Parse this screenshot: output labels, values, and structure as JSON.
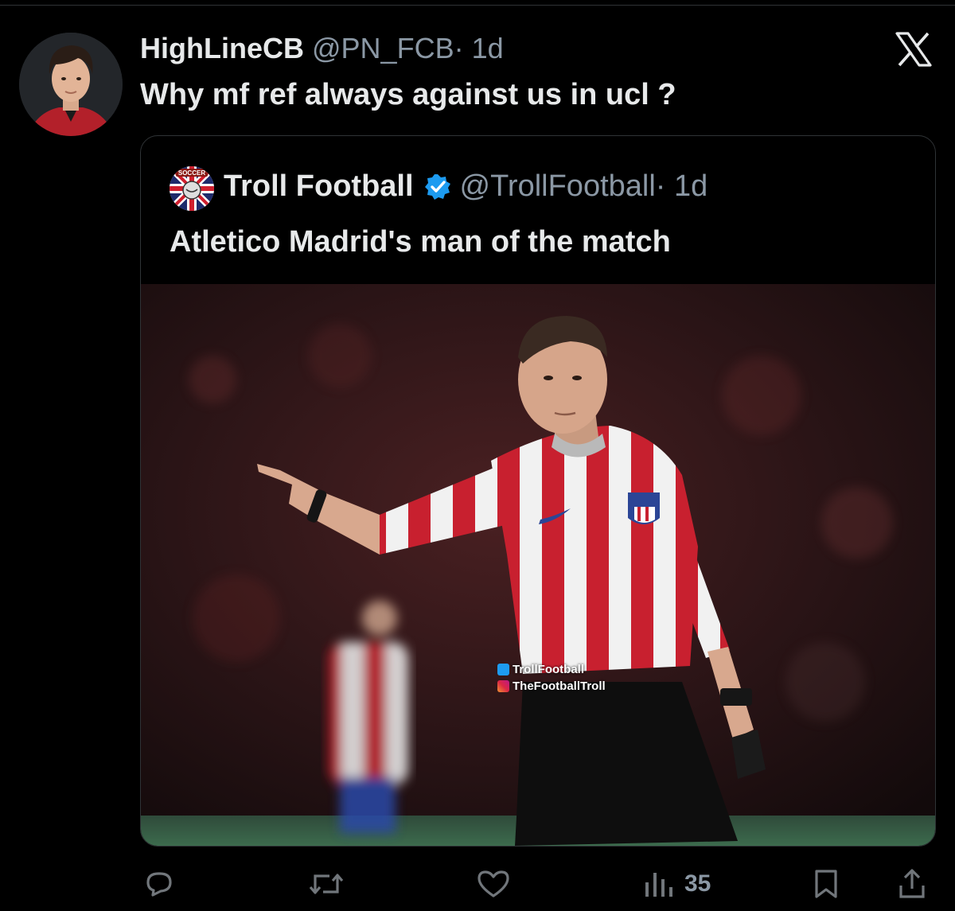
{
  "tweet": {
    "display_name": "HighLineCB",
    "handle": "@PN_FCB",
    "time": "· 1d",
    "text": "Why mf ref always against us in ucl ?"
  },
  "quoted_tweet": {
    "display_name": "Troll Football",
    "handle": "@TrollFootball",
    "time": "· 1d",
    "text": "Atletico Madrid's man of the match",
    "avatar_lettering": "SOCCER",
    "media": {
      "watermark_twitter": "TrollFootball",
      "watermark_instagram": "TheFootballTroll"
    }
  },
  "actions": {
    "reply_icon": "reply-icon",
    "retweet_icon": "retweet-icon",
    "like_icon": "like-icon",
    "views_icon": "views-icon",
    "views_count": "35",
    "bookmark_icon": "bookmark-icon",
    "share_icon": "share-icon"
  },
  "colors": {
    "background": "#000000",
    "text": "#e7e9ea",
    "muted": "#8b98a5",
    "verified": "#1d9bf0",
    "border": "#2f3336"
  }
}
